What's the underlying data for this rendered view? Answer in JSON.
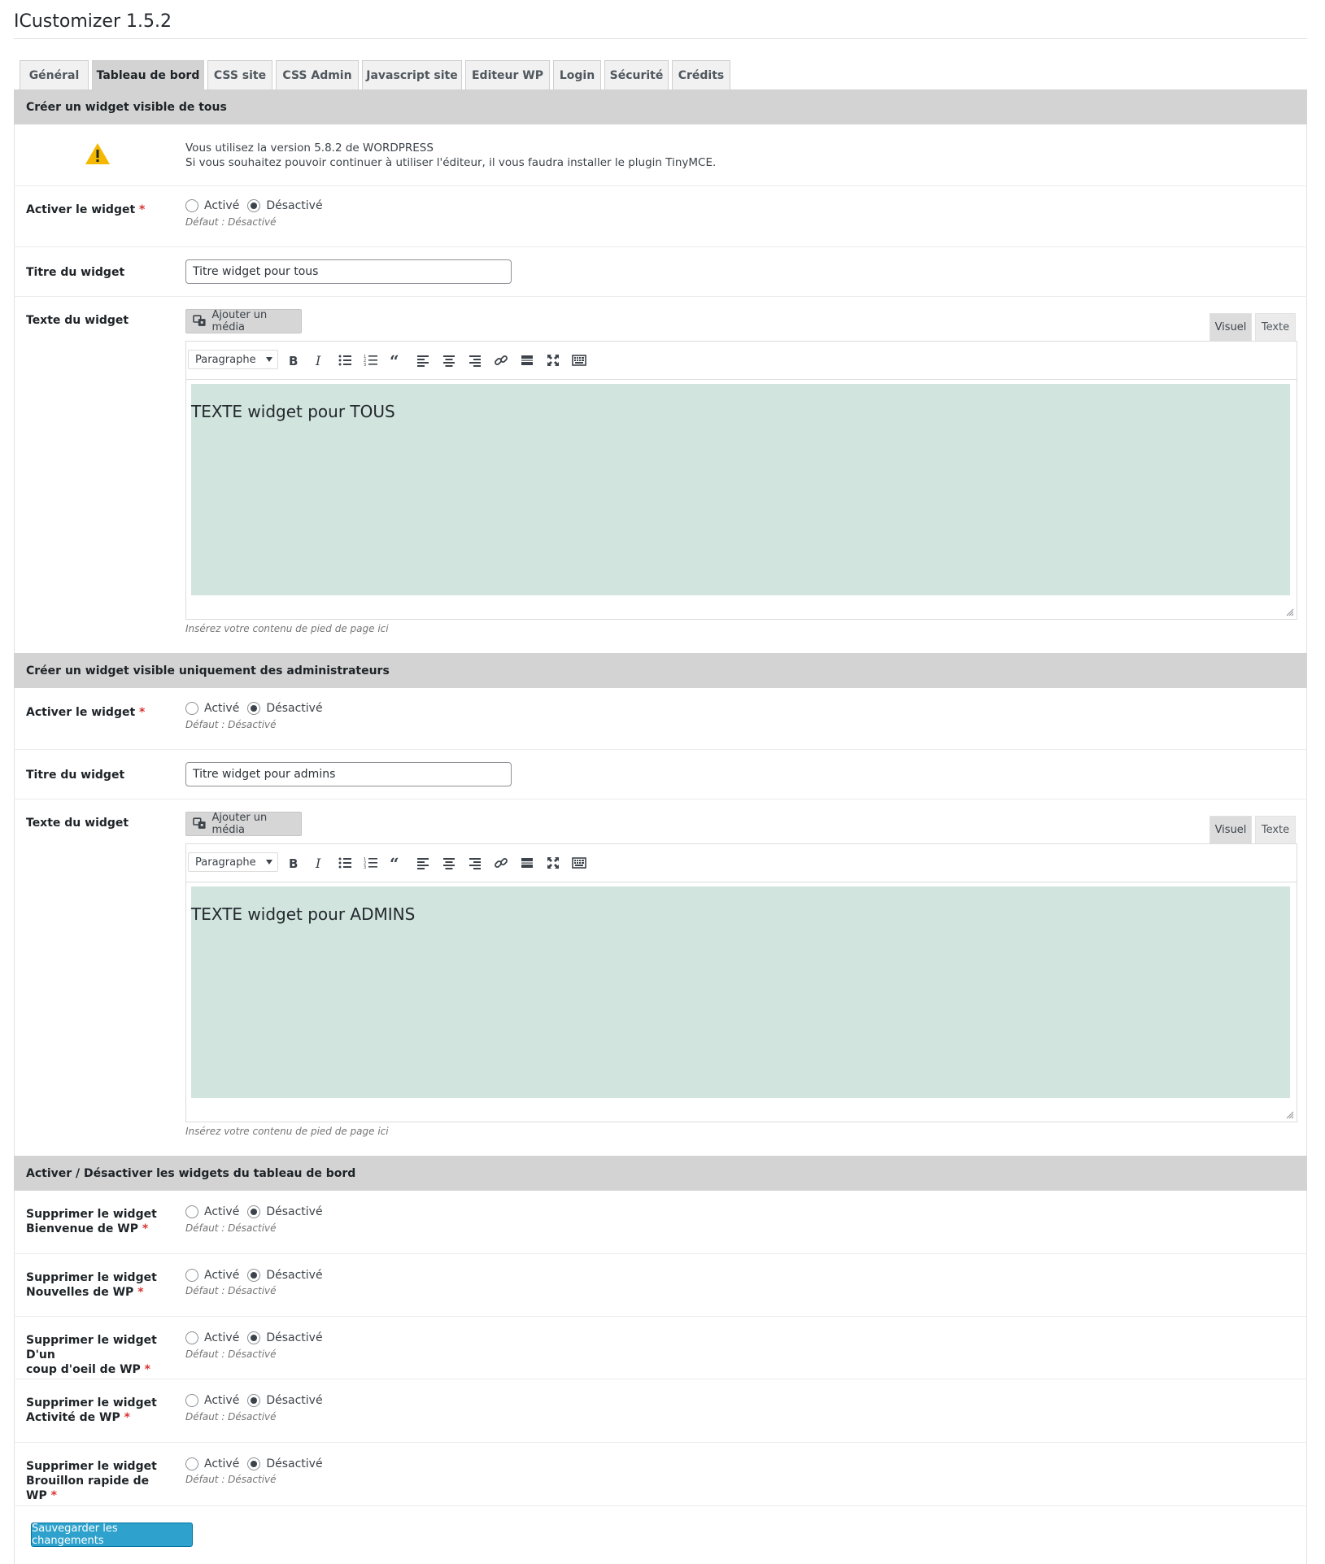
{
  "app": {
    "title": "ICustomizer 1.5.2"
  },
  "tabs": [
    {
      "label": "Général"
    },
    {
      "label": "Tableau de bord",
      "active": true
    },
    {
      "label": "CSS site"
    },
    {
      "label": "CSS Admin"
    },
    {
      "label": "Javascript site"
    },
    {
      "label": "Editeur WP"
    },
    {
      "label": "Login"
    },
    {
      "label": "Sécurité"
    },
    {
      "label": "Crédits"
    }
  ],
  "section_all": {
    "heading": "Créer un widget visible de tous",
    "notice_line1": "Vous utilisez la version 5.8.2 de WORDPRESS",
    "notice_line2": "Si vous souhaitez pouvoir continuer à utiliser l'éditeur, il vous faudra installer le plugin TinyMCE.",
    "activate_label": "Activer le widget",
    "title_label": "Titre du widget",
    "title_value": "Titre widget pour tous",
    "text_label": "Texte du widget",
    "editor_content": "TEXTE widget pour TOUS",
    "hint": "Insérez votre contenu de pied de page ici"
  },
  "section_admins": {
    "heading": "Créer un widget visible uniquement des administrateurs",
    "activate_label": "Activer le widget",
    "title_label": "Titre du widget",
    "title_value": "Titre widget pour admins",
    "text_label": "Texte du widget",
    "editor_content": "TEXTE widget pour ADMINS",
    "hint": "Insérez votre contenu de pied de page ici"
  },
  "section_dashboard": {
    "heading": "Activer / Désactiver les widgets du tableau de bord",
    "rows": [
      {
        "line1": "Supprimer le widget",
        "line2": "Bienvenue de WP"
      },
      {
        "line1": "Supprimer le widget",
        "line2": "Nouvelles de WP"
      },
      {
        "line1": "Supprimer le widget D'un",
        "line2": "coup d'oeil de WP"
      },
      {
        "line1": "Supprimer le widget",
        "line2": "Activité de WP"
      },
      {
        "line1": "Supprimer le widget",
        "line2": "Brouillon rapide de WP"
      }
    ]
  },
  "common": {
    "required_mark": "*",
    "opt_on": "Activé",
    "opt_off": "Désactivé",
    "default_note": "Défaut : Désactivé",
    "selected": "Désactivé",
    "media_button": "Ajouter un média",
    "mode_visual": "Visuel",
    "mode_text": "Texte",
    "format_select": "Paragraphe"
  },
  "toolbar_icons": [
    "bold-icon",
    "italic-icon",
    "bullet-list-icon",
    "numbered-list-icon",
    "blockquote-icon",
    "align-left-icon",
    "align-center-icon",
    "align-right-icon",
    "link-icon",
    "read-more-icon",
    "fullscreen-icon",
    "toolbar-toggle-icon"
  ],
  "save_button": "Sauvegarder les changements",
  "colors": {
    "section_bg": "#d3d3d3",
    "editor_bg": "#d1e4de",
    "primary": "#2ea2cc",
    "required": "#dc3232"
  }
}
